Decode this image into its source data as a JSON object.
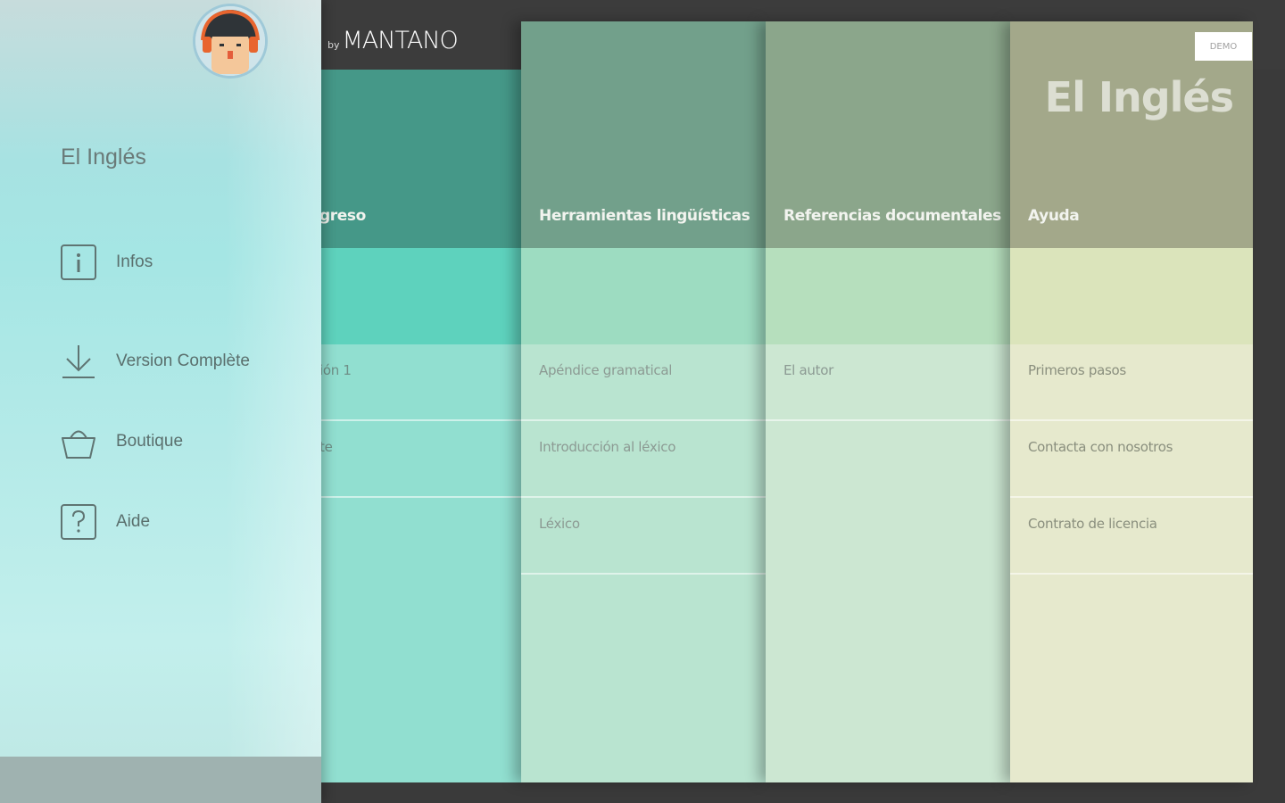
{
  "brand": {
    "by": "by",
    "name": "MANTANO"
  },
  "app": {
    "title": "El Inglés",
    "badge": "DEMO"
  },
  "drawer": {
    "title": "El Inglés",
    "items": [
      {
        "label": "Infos",
        "icon": "info-icon"
      },
      {
        "label": "Version Complète",
        "icon": "download-icon"
      },
      {
        "label": "Boutique",
        "icon": "basket-icon"
      },
      {
        "label": "Aide",
        "icon": "help-icon"
      }
    ]
  },
  "columns": [
    {
      "title": "greso",
      "items": [
        "ión 1",
        "te"
      ]
    },
    {
      "title": "Herramientas lingüísticas",
      "items": [
        "Apéndice gramatical",
        "Introducción al léxico",
        "Léxico"
      ]
    },
    {
      "title": "Referencias documentales",
      "items": [
        "El autor"
      ]
    },
    {
      "title": "Ayuda",
      "items": [
        "Primeros pasos",
        "Contacta con nosotros",
        "Contrato de licencia"
      ]
    }
  ]
}
